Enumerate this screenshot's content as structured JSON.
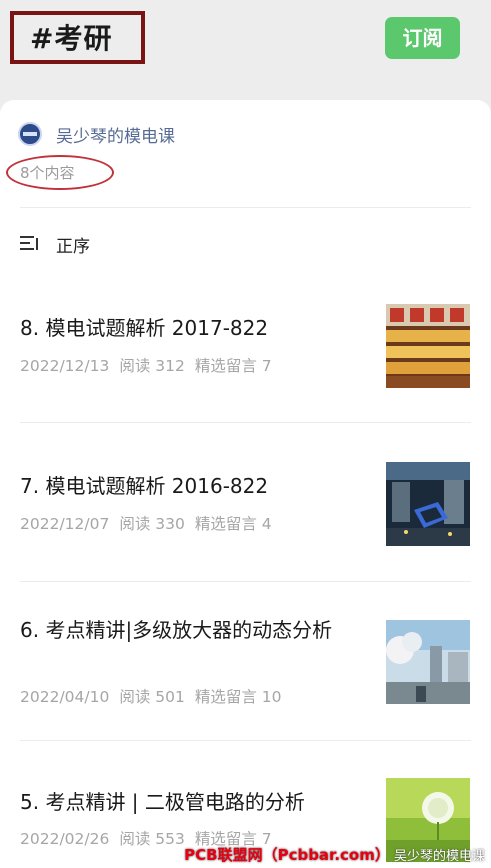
{
  "header": {
    "tag": "#考研",
    "subscribe_label": "订阅"
  },
  "account": {
    "name": "吴少琴的模电课",
    "content_count": "8个内容"
  },
  "sort": {
    "label": "正序"
  },
  "articles": [
    {
      "title": "8. 模电试题解析 2017-822",
      "date": "2022/12/13",
      "reads": "阅读 312",
      "comments": "精选留言 7",
      "thumb": "thumbnail-food-stall"
    },
    {
      "title": "7. 模电试题解析 2016-822",
      "date": "2022/12/07",
      "reads": "阅读 330",
      "comments": "精选留言 4",
      "thumb": "thumbnail-night-city"
    },
    {
      "title": "6. 考点精讲|多级放大器的动态分析",
      "date": "2022/04/10",
      "reads": "阅读 501",
      "comments": "精选留言 10",
      "thumb": "thumbnail-street-blossom"
    },
    {
      "title": "5. 考点精讲 | 二极管电路的分析",
      "date": "2022/02/26",
      "reads": "阅读 553",
      "comments": "精选留言 7",
      "thumb": "thumbnail-dandelion"
    }
  ],
  "watermark": {
    "site": "PCB联盟网（Pcbbar.com）",
    "author": "吴少琴的模电课"
  }
}
